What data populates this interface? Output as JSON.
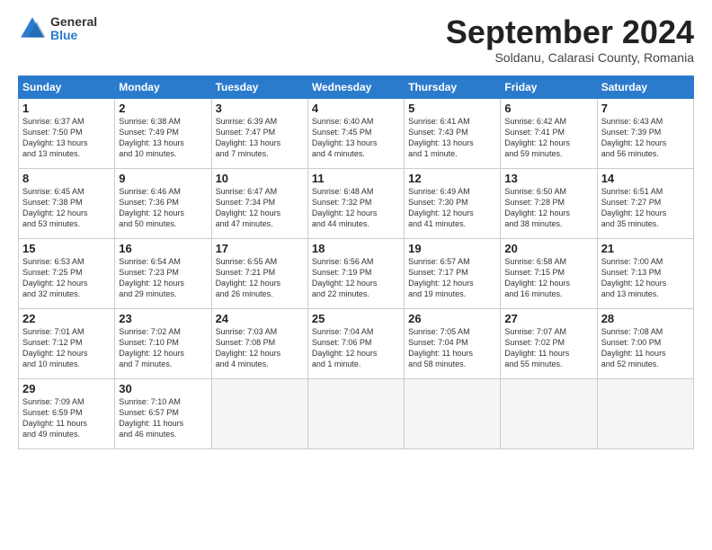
{
  "header": {
    "logo_general": "General",
    "logo_blue": "Blue",
    "month_title": "September 2024",
    "subtitle": "Soldanu, Calarasi County, Romania"
  },
  "days_of_week": [
    "Sunday",
    "Monday",
    "Tuesday",
    "Wednesday",
    "Thursday",
    "Friday",
    "Saturday"
  ],
  "weeks": [
    [
      {
        "day": "1",
        "info": "Sunrise: 6:37 AM\nSunset: 7:50 PM\nDaylight: 13 hours\nand 13 minutes."
      },
      {
        "day": "2",
        "info": "Sunrise: 6:38 AM\nSunset: 7:49 PM\nDaylight: 13 hours\nand 10 minutes."
      },
      {
        "day": "3",
        "info": "Sunrise: 6:39 AM\nSunset: 7:47 PM\nDaylight: 13 hours\nand 7 minutes."
      },
      {
        "day": "4",
        "info": "Sunrise: 6:40 AM\nSunset: 7:45 PM\nDaylight: 13 hours\nand 4 minutes."
      },
      {
        "day": "5",
        "info": "Sunrise: 6:41 AM\nSunset: 7:43 PM\nDaylight: 13 hours\nand 1 minute."
      },
      {
        "day": "6",
        "info": "Sunrise: 6:42 AM\nSunset: 7:41 PM\nDaylight: 12 hours\nand 59 minutes."
      },
      {
        "day": "7",
        "info": "Sunrise: 6:43 AM\nSunset: 7:39 PM\nDaylight: 12 hours\nand 56 minutes."
      }
    ],
    [
      {
        "day": "8",
        "info": "Sunrise: 6:45 AM\nSunset: 7:38 PM\nDaylight: 12 hours\nand 53 minutes."
      },
      {
        "day": "9",
        "info": "Sunrise: 6:46 AM\nSunset: 7:36 PM\nDaylight: 12 hours\nand 50 minutes."
      },
      {
        "day": "10",
        "info": "Sunrise: 6:47 AM\nSunset: 7:34 PM\nDaylight: 12 hours\nand 47 minutes."
      },
      {
        "day": "11",
        "info": "Sunrise: 6:48 AM\nSunset: 7:32 PM\nDaylight: 12 hours\nand 44 minutes."
      },
      {
        "day": "12",
        "info": "Sunrise: 6:49 AM\nSunset: 7:30 PM\nDaylight: 12 hours\nand 41 minutes."
      },
      {
        "day": "13",
        "info": "Sunrise: 6:50 AM\nSunset: 7:28 PM\nDaylight: 12 hours\nand 38 minutes."
      },
      {
        "day": "14",
        "info": "Sunrise: 6:51 AM\nSunset: 7:27 PM\nDaylight: 12 hours\nand 35 minutes."
      }
    ],
    [
      {
        "day": "15",
        "info": "Sunrise: 6:53 AM\nSunset: 7:25 PM\nDaylight: 12 hours\nand 32 minutes."
      },
      {
        "day": "16",
        "info": "Sunrise: 6:54 AM\nSunset: 7:23 PM\nDaylight: 12 hours\nand 29 minutes."
      },
      {
        "day": "17",
        "info": "Sunrise: 6:55 AM\nSunset: 7:21 PM\nDaylight: 12 hours\nand 26 minutes."
      },
      {
        "day": "18",
        "info": "Sunrise: 6:56 AM\nSunset: 7:19 PM\nDaylight: 12 hours\nand 22 minutes."
      },
      {
        "day": "19",
        "info": "Sunrise: 6:57 AM\nSunset: 7:17 PM\nDaylight: 12 hours\nand 19 minutes."
      },
      {
        "day": "20",
        "info": "Sunrise: 6:58 AM\nSunset: 7:15 PM\nDaylight: 12 hours\nand 16 minutes."
      },
      {
        "day": "21",
        "info": "Sunrise: 7:00 AM\nSunset: 7:13 PM\nDaylight: 12 hours\nand 13 minutes."
      }
    ],
    [
      {
        "day": "22",
        "info": "Sunrise: 7:01 AM\nSunset: 7:12 PM\nDaylight: 12 hours\nand 10 minutes."
      },
      {
        "day": "23",
        "info": "Sunrise: 7:02 AM\nSunset: 7:10 PM\nDaylight: 12 hours\nand 7 minutes."
      },
      {
        "day": "24",
        "info": "Sunrise: 7:03 AM\nSunset: 7:08 PM\nDaylight: 12 hours\nand 4 minutes."
      },
      {
        "day": "25",
        "info": "Sunrise: 7:04 AM\nSunset: 7:06 PM\nDaylight: 12 hours\nand 1 minute."
      },
      {
        "day": "26",
        "info": "Sunrise: 7:05 AM\nSunset: 7:04 PM\nDaylight: 11 hours\nand 58 minutes."
      },
      {
        "day": "27",
        "info": "Sunrise: 7:07 AM\nSunset: 7:02 PM\nDaylight: 11 hours\nand 55 minutes."
      },
      {
        "day": "28",
        "info": "Sunrise: 7:08 AM\nSunset: 7:00 PM\nDaylight: 11 hours\nand 52 minutes."
      }
    ],
    [
      {
        "day": "29",
        "info": "Sunrise: 7:09 AM\nSunset: 6:59 PM\nDaylight: 11 hours\nand 49 minutes."
      },
      {
        "day": "30",
        "info": "Sunrise: 7:10 AM\nSunset: 6:57 PM\nDaylight: 11 hours\nand 46 minutes."
      },
      {
        "day": "",
        "info": ""
      },
      {
        "day": "",
        "info": ""
      },
      {
        "day": "",
        "info": ""
      },
      {
        "day": "",
        "info": ""
      },
      {
        "day": "",
        "info": ""
      }
    ]
  ]
}
